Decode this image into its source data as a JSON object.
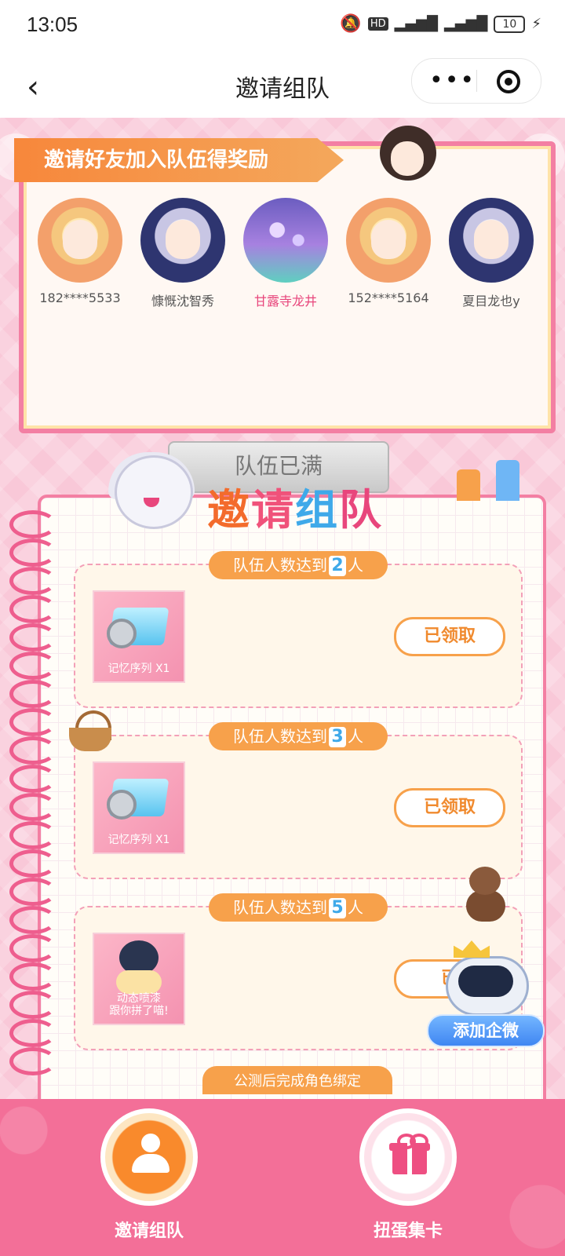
{
  "status": {
    "time": "13:05",
    "battery": "10"
  },
  "nav": {
    "title": "邀请组队"
  },
  "team": {
    "banner": "邀请好友加入队伍得奖励",
    "members": [
      {
        "name": "182****5533"
      },
      {
        "name": "慷慨沈智秀"
      },
      {
        "name": "甘露寺龙井"
      },
      {
        "name": "152****5164"
      },
      {
        "name": "夏目龙也y"
      }
    ],
    "full_button": "队伍已满"
  },
  "section": {
    "title_parts": [
      "邀",
      "请",
      "组",
      "队"
    ]
  },
  "tiers": [
    {
      "prefix": "队伍人数达到",
      "count": "2",
      "suffix": "人",
      "reward": "记忆序列 X1",
      "status": "已领取"
    },
    {
      "prefix": "队伍人数达到",
      "count": "3",
      "suffix": "人",
      "reward": "记忆序列 X1",
      "status": "已领取"
    },
    {
      "prefix": "队伍人数达到",
      "count": "5",
      "suffix": "人",
      "reward_line1": "动态喷漆",
      "reward_line2": "跟你拼了喵!",
      "status": "已"
    }
  ],
  "next_tier_label": "公测后完成角色绑定",
  "floating": {
    "wecom_label": "添加企微"
  },
  "tabbar": {
    "items": [
      {
        "label": "邀请组队"
      },
      {
        "label": "扭蛋集卡"
      }
    ]
  },
  "colors": {
    "accent_orange": "#f7a14b",
    "accent_pink": "#f37fa3",
    "wecom_blue": "#3f86f2"
  }
}
